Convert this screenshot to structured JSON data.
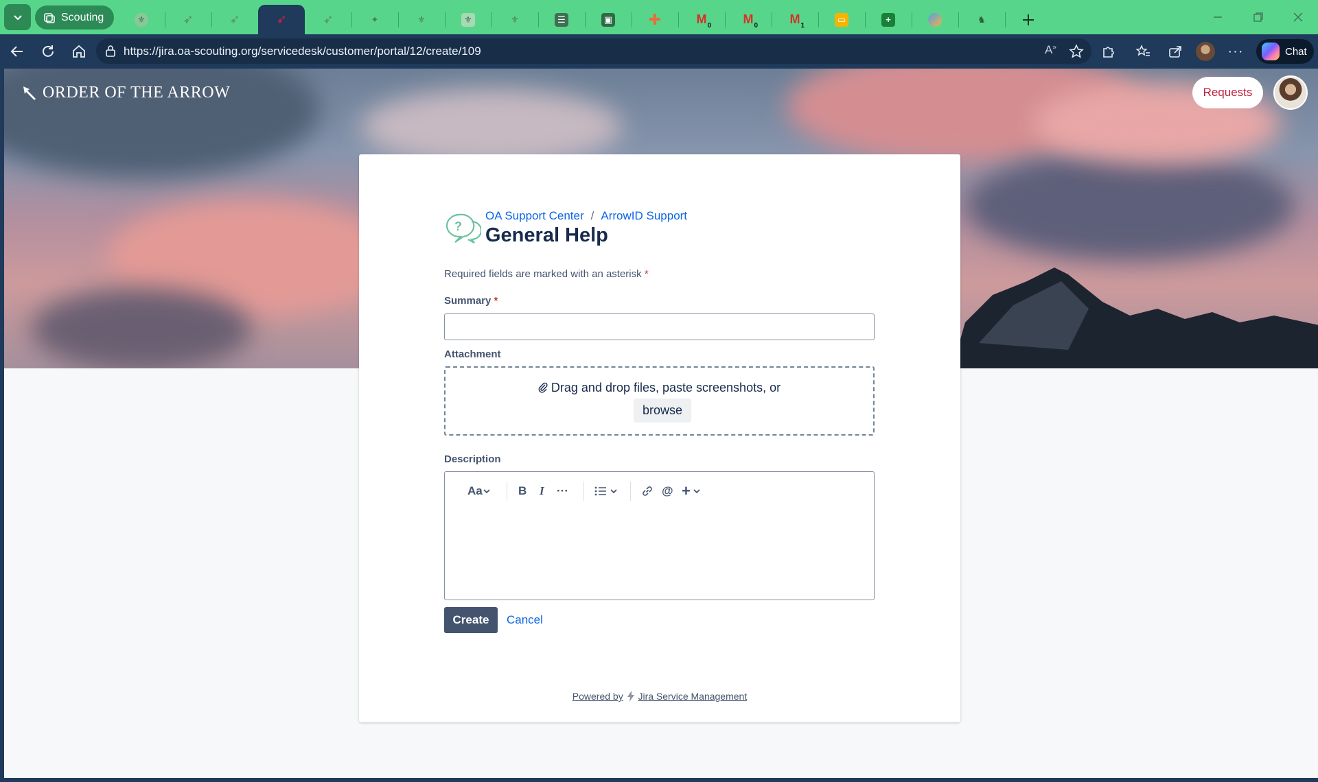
{
  "browser": {
    "tab_group_label": "Scouting",
    "address_url": "https://jira.oa-scouting.org/servicedesk/customer/portal/12/create/109",
    "chat_label": "Chat",
    "tab_badges": [
      "0",
      "0",
      "1"
    ]
  },
  "header": {
    "brand": "ORDER OF THE ARROW",
    "requests_label": "Requests"
  },
  "form": {
    "breadcrumb_root": "OA Support Center",
    "breadcrumb_separator": "/",
    "breadcrumb_current": "ArrowID Support",
    "title": "General Help",
    "required_note": "Required fields are marked with an asterisk",
    "required_marker": "*",
    "summary_label": "Summary",
    "summary_value": "",
    "attachment_label": "Attachment",
    "dropzone_text": "Drag and drop files, paste screenshots, or",
    "browse_label": "browse",
    "description_label": "Description",
    "editor_toolbar": {
      "text_style": "Aa",
      "bold": "B",
      "italic": "I",
      "more": "···",
      "mention": "@",
      "insert": "+"
    },
    "create_label": "Create",
    "cancel_label": "Cancel"
  },
  "footer": {
    "powered_prefix": "Powered by",
    "powered_product": "Jira Service Management"
  },
  "colors": {
    "tabstrip": "#57d68b",
    "toolbar": "#1f3a5a",
    "link": "#0c66e4",
    "primary_button": "#44546f",
    "requests_text": "#c0213a"
  }
}
